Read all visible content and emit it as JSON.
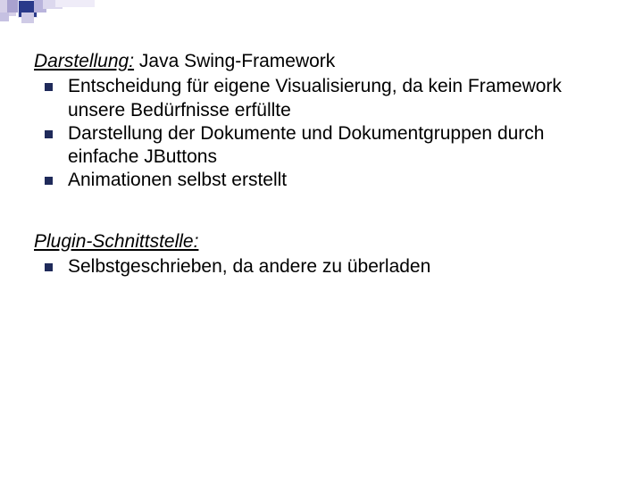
{
  "section1": {
    "label": "Darstellung:",
    "suffix": " Java Swing-Framework",
    "items": [
      "Entscheidung für eigene Visualisierung, da kein Framework unsere Bedürfnisse erfüllte",
      "Darstellung der Dokumente und Dokumentgruppen durch einfache JButtons",
      "Animationen selbst erstellt"
    ]
  },
  "section2": {
    "label": "Plugin-Schnittstelle:",
    "items": [
      "Selbstgeschrieben, da andere zu überladen"
    ]
  }
}
